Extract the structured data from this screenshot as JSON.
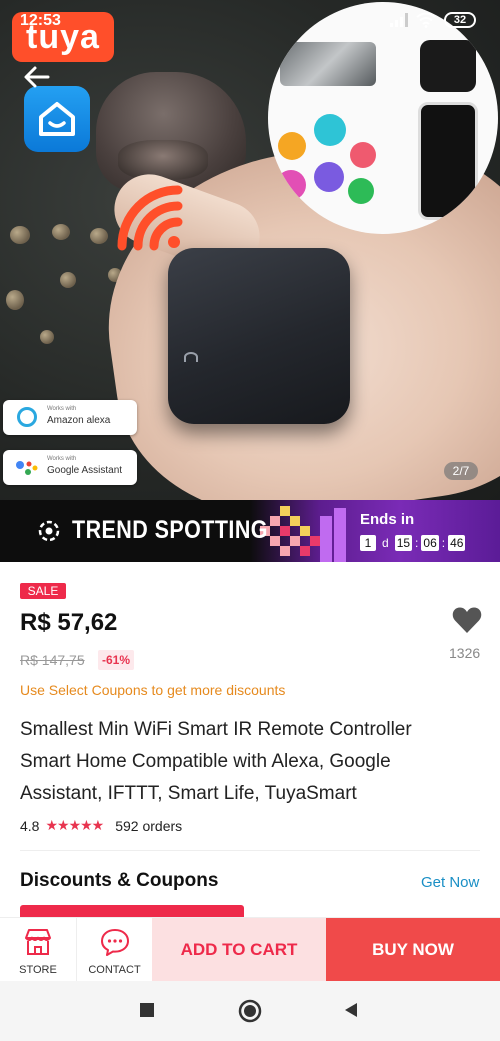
{
  "status_bar": {
    "time": "12:53",
    "battery": "32"
  },
  "hero": {
    "brand": "tuya",
    "badges": [
      {
        "works_with": "Works with",
        "name": "Amazon alexa"
      },
      {
        "works_with": "Works with",
        "name": "Google Assistant"
      }
    ],
    "pager": "2/7"
  },
  "promo": {
    "title": "TREND SPOTTING",
    "ends_label": "Ends in",
    "days": "1",
    "days_unit": "d",
    "hours": "15",
    "minutes": "06",
    "seconds": "46"
  },
  "product": {
    "sale_tag": "SALE",
    "price": "R$ 57,62",
    "old_price": "R$ 147,75",
    "discount": "-61%",
    "wishlist_count": "1326",
    "coupon_line": "Use Select Coupons to get more discounts",
    "title": "Smallest Min WiFi Smart IR Remote Controller Smart Home Compatible with Alexa, Google Assistant, IFTTT, Smart Life, TuyaSmart",
    "rating": "4.8",
    "stars": "★★★★★",
    "orders": "592 orders"
  },
  "discounts": {
    "title": "Discounts & Coupons",
    "get_now": "Get Now"
  },
  "actions": {
    "store": "STORE",
    "contact": "CONTACT",
    "add_to_cart": "ADD TO CART",
    "buy_now": "BUY NOW"
  },
  "colors": {
    "accent": "#ee2a4a",
    "buy_now": "#f04a4a",
    "link": "#1a8fc5",
    "coupon": "#e68a1e"
  }
}
